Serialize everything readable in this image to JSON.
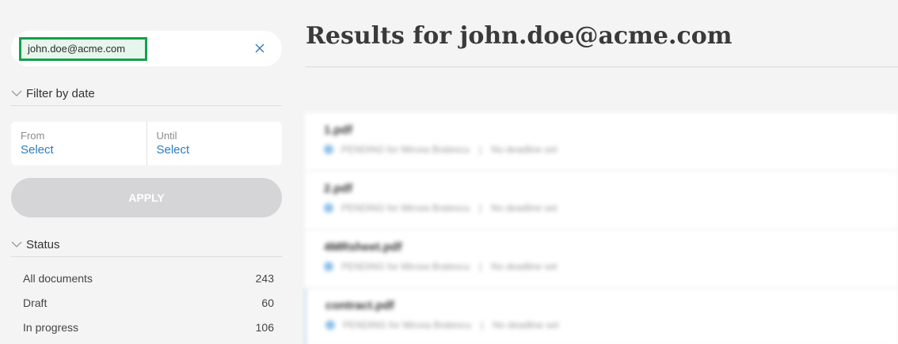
{
  "search": {
    "query": "john.doe@acme.com"
  },
  "filter_by_date": {
    "heading": "Filter by date",
    "from_label": "From",
    "from_value": "Select",
    "until_label": "Until",
    "until_value": "Select",
    "apply_label": "APPLY"
  },
  "status": {
    "heading": "Status",
    "items": [
      {
        "label": "All documents",
        "count": "243"
      },
      {
        "label": "Draft",
        "count": "60"
      },
      {
        "label": "In progress",
        "count": "106"
      }
    ]
  },
  "main": {
    "title": "Results for john.doe@acme.com",
    "documents": [
      {
        "name": "1.pdf",
        "status": "PENDING for Mircea Bratescu",
        "deadline": "No deadline set"
      },
      {
        "name": "2.pdf",
        "status": "PENDING for Mircea Bratescu",
        "deadline": "No deadline set"
      },
      {
        "name": "4MRsheet.pdf",
        "status": "PENDING for Mircea Bratescu",
        "deadline": "No deadline set"
      },
      {
        "name": "contract.pdf",
        "status": "PENDING for Mircea Bratescu",
        "deadline": "No deadline set"
      }
    ]
  },
  "colors": {
    "chip_border": "#14a04a",
    "link": "#2b7bc0",
    "apply_disabled": "#d5d5d7"
  }
}
